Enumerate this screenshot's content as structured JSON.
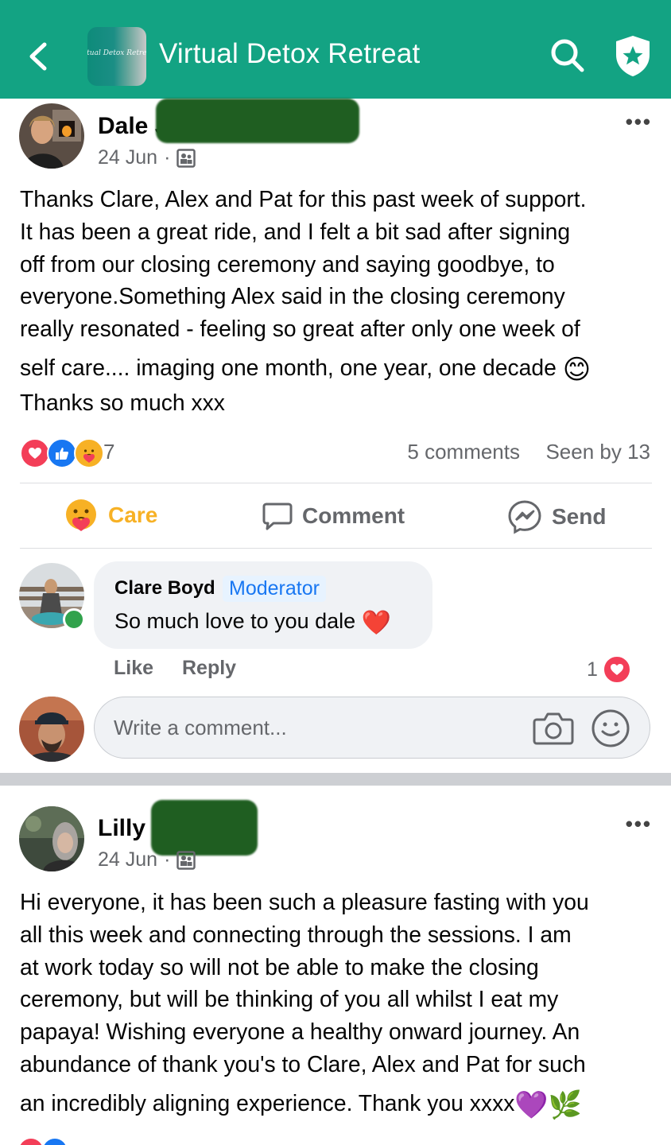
{
  "header": {
    "title": "Virtual Detox Retreat",
    "thumb_text": "irtual Detox Retre",
    "colors": {
      "bar": "#13a383",
      "icon": "#ffffff"
    },
    "icons": {
      "back": "chevron-left-icon",
      "search": "search-icon",
      "admin": "shield-star-icon"
    }
  },
  "posts": [
    {
      "author_visible": "Dale J",
      "date": "24 Jun",
      "separator": "·",
      "privacy_icon": "members-icon",
      "more": "•••",
      "body_lines": [
        "Thanks Clare, Alex and Pat for this past week of support.",
        "It has been a great ride, and I felt a bit sad after signing",
        "off from our closing ceremony and saying goodbye, to",
        "everyone.Something Alex said in the closing ceremony",
        "really resonated - feeling so great after only one week of",
        "self care.... imaging one month, one year, one decade",
        "Thanks so much xxx"
      ],
      "body_emoji": "😊",
      "reactions": {
        "icons": [
          "love-icon",
          "like-icon",
          "care-icon"
        ],
        "count": "7"
      },
      "comments_count": "5 comments",
      "seen_by": "Seen by 13",
      "actions": {
        "care": "Care",
        "comment": "Comment",
        "send": "Send"
      },
      "comment": {
        "author": "Clare Boyd",
        "badge": "Moderator",
        "text": "So much love to you dale",
        "emoji": "❤️",
        "like": "Like",
        "reply": "Reply",
        "reaction_count": "1",
        "online": true
      },
      "write_comment": {
        "placeholder": "Write a comment..."
      }
    },
    {
      "author_visible": "Lilly E",
      "date": "24 Jun",
      "separator": "·",
      "privacy_icon": "members-icon",
      "more": "•••",
      "body_lines": [
        "Hi everyone, it has been such a pleasure fasting with you",
        "all this week and connecting through the sessions. I am",
        "at work today so will not be able to make the closing",
        "ceremony, but will be thinking of you all whilst I eat my",
        "papaya! Wishing everyone a healthy onward journey. An",
        "abundance of thank you's to Clare, Alex and Pat for such",
        "an incredibly aligning experience. Thank you xxxx"
      ],
      "body_emojis": [
        "💜",
        "🌿"
      ]
    }
  ]
}
